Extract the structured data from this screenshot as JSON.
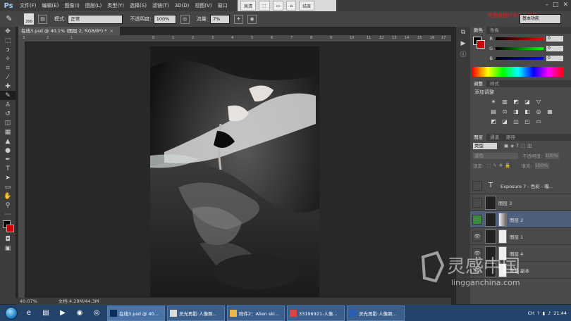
{
  "app": {
    "logo": "Ps"
  },
  "menubar": {
    "items": [
      "文件(F)",
      "编辑(E)",
      "图像(I)",
      "图层(L)",
      "类型(Y)",
      "选择(S)",
      "滤镜(T)",
      "3D(D)",
      "视图(V)",
      "窗口"
    ],
    "overlay_buttons": [
      "高清",
      "结束"
    ]
  },
  "options": {
    "brush_size": "200",
    "mode_label": "模式:",
    "mode_value": "正常",
    "opacity_label": "不透明度:",
    "opacity_value": "100%",
    "flow_label": "流量:",
    "flow_value": "7%",
    "workspace": "基本功能",
    "red_note": "观看教程时点击此屏幕"
  },
  "document": {
    "tab_title": "在线3.psd @ 40.1% (图层 2, RGB/8*) *",
    "close_glyph": "×",
    "ruler_ticks": [
      "3",
      "2",
      "1",
      "0",
      "1",
      "2",
      "3",
      "4",
      "5",
      "6",
      "7",
      "8",
      "9",
      "10",
      "11",
      "12",
      "13",
      "14",
      "15",
      "16",
      "17",
      "18"
    ],
    "zoom": "40.07%",
    "doc_info": "文档:4.29M/44.3M"
  },
  "color_panel": {
    "tabs": [
      "颜色",
      "色板"
    ],
    "channels": [
      {
        "name": "R",
        "value": "0"
      },
      {
        "name": "G",
        "value": "0"
      },
      {
        "name": "B",
        "value": "0"
      }
    ]
  },
  "adjust_panel": {
    "tabs": [
      "调整",
      "样式"
    ],
    "title": "添加调整"
  },
  "layers_panel": {
    "tabs": [
      "图层",
      "通道",
      "路径"
    ],
    "filter_kind": "类型",
    "blend_mode": "滤色",
    "opacity_label": "不透明度:",
    "opacity_value": "100%",
    "lock_label": "锁定:",
    "fill_label": "填充:",
    "fill_value": "100%",
    "layers": [
      {
        "name": "Exposure 7 - 色彩 - 曝...",
        "type": "text",
        "visible": false,
        "selected": false
      },
      {
        "name": "图层 3",
        "type": "image",
        "visible": false,
        "selected": false
      },
      {
        "name": "图层 2",
        "type": "image",
        "visible": true,
        "selected": true
      },
      {
        "name": "图层 1",
        "type": "image",
        "visible": true,
        "selected": false
      },
      {
        "name": "图层 4",
        "type": "image",
        "visible": true,
        "selected": false
      },
      {
        "name": "背景 副本",
        "type": "image",
        "visible": true,
        "selected": false
      }
    ]
  },
  "taskbar": {
    "tasks": [
      "在线3.psd @ 40...",
      "灵光再影·人像照...",
      "附件2：Alien ski...",
      "33196921-人像...",
      "灵光再影·人像照..."
    ],
    "lang": "CH",
    "time": "21:44"
  },
  "watermark": {
    "brand": "灵感中国",
    "url": "lingganchina.com"
  },
  "colors": {
    "fg": "#000000",
    "bg": "#cc0000",
    "accent": "#4e5f7e",
    "taskbar": "#23436b"
  }
}
